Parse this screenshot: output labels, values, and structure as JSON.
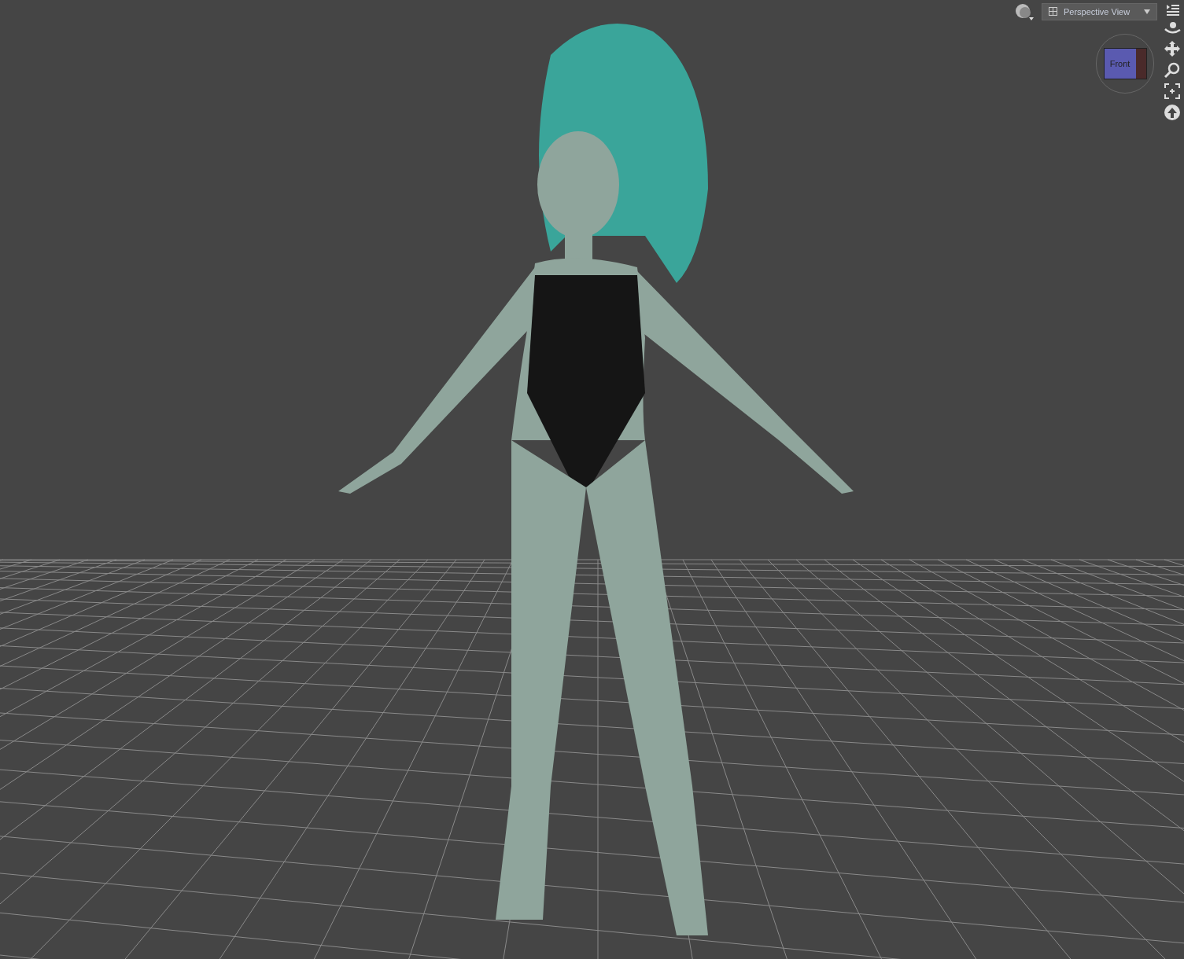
{
  "viewport": {
    "view_dropdown": {
      "label": "Perspective View"
    },
    "view_cube": {
      "face": "Front"
    }
  }
}
